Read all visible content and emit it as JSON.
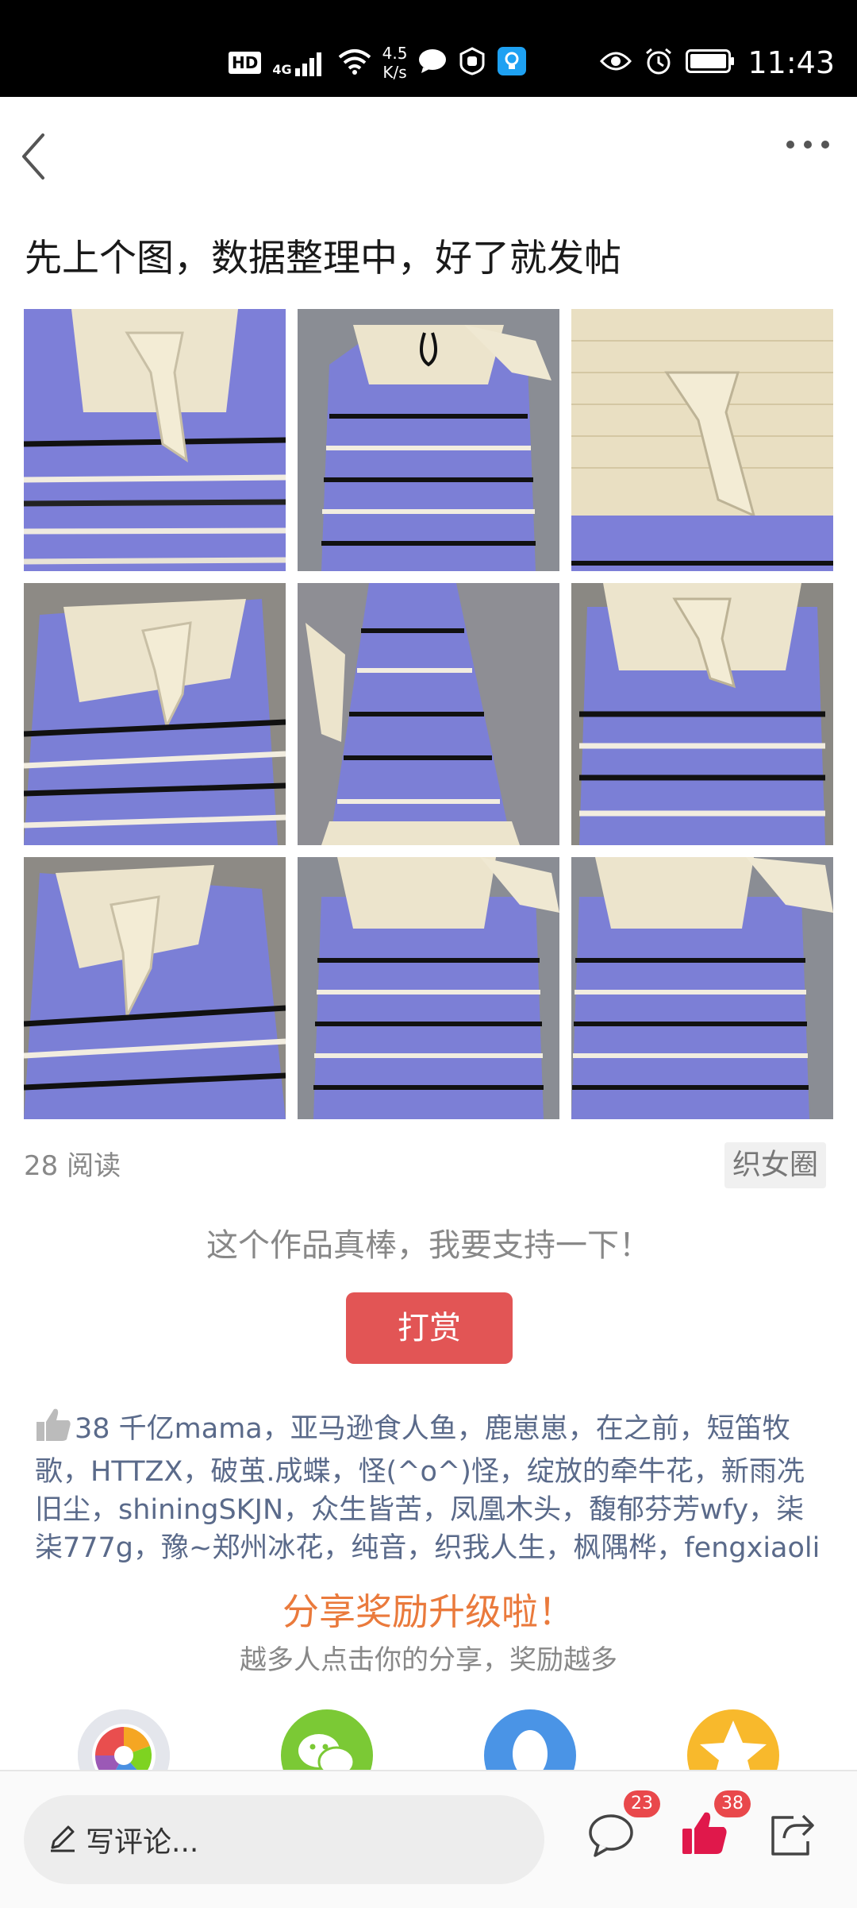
{
  "status_bar": {
    "hd": "HD",
    "network": "4G",
    "speed_value": "4.5",
    "speed_unit": "K/s",
    "time": "11:43"
  },
  "nav": {
    "back_icon": "chevron-left-icon",
    "more_icon": "more-dots-icon"
  },
  "post": {
    "title": "先上个图，数据整理中，好了就发帖",
    "read_count": "28 阅读",
    "circle": "织女圈"
  },
  "reward": {
    "prompt": "这个作品真棒，我要支持一下！",
    "button": "打赏"
  },
  "likes": {
    "text": "38 千亿mama，亚马逊食人鱼，鹿崽崽，在之前，短笛牧歌，HTTZX，破茧.成蝶，怪(^o^)怪，绽放的牵牛花，新雨冼旧尘，shiningSKJN，众生皆苦，凤凰木头，馥郁芬芳wfy，柒柒777g，豫~郑州冰花，纯音，织我人生，枫隅桦，fengxiaoli"
  },
  "share": {
    "title": "分享奖励升级啦！",
    "subtitle": "越多人点击你的分享，奖励越多"
  },
  "bottom_bar": {
    "comment_placeholder": "写评论...",
    "comment_count": "23",
    "like_count": "38"
  },
  "colors": {
    "reward_button": "#e25555",
    "share_title": "#ea7a3c",
    "liker_names": "#5a6a8a",
    "badge": "#e9484b",
    "like_active": "#e0184b"
  }
}
